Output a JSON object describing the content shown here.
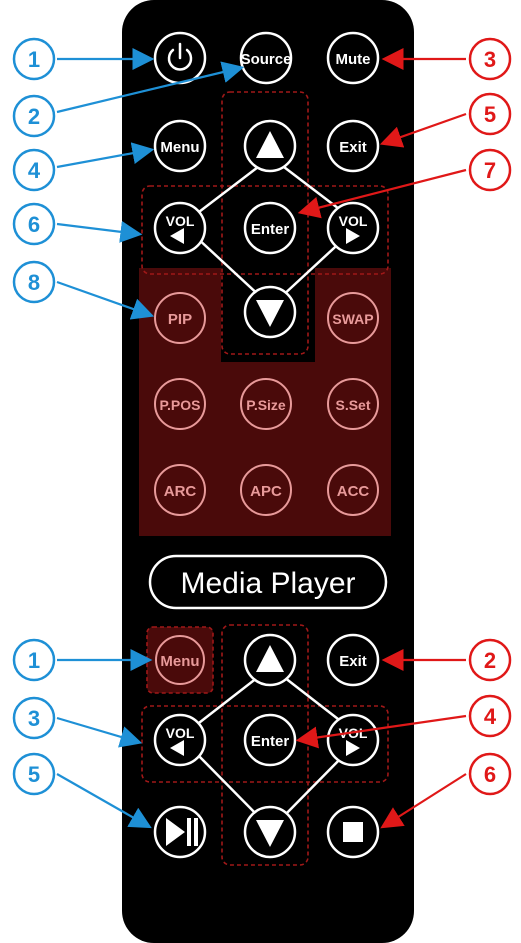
{
  "colors": {
    "body": "#000000",
    "red_zone": "#4a0a0a",
    "dashed": "#a01818",
    "callout_blue": "#1e90d6",
    "callout_red": "#e01818",
    "dim_text": "#e89a9a"
  },
  "top_section": {
    "buttons": {
      "power_icon": "power-icon",
      "source": "Source",
      "mute": "Mute",
      "menu": "Menu",
      "exit": "Exit",
      "up_icon": "triangle-up-icon",
      "down_icon": "triangle-down-icon",
      "enter": "Enter",
      "vol_left": "VOL",
      "vol_right": "VOL",
      "pip": "PIP",
      "swap": "SWAP",
      "ppos": "P.POS",
      "psize": "P.Size",
      "sset": "S.Set",
      "arc": "ARC",
      "apc": "APC",
      "acc": "ACC"
    },
    "callouts": [
      "1",
      "2",
      "3",
      "4",
      "5",
      "6",
      "7",
      "8"
    ]
  },
  "media_player": {
    "label": "Media Player",
    "buttons": {
      "menu": "Menu",
      "exit": "Exit",
      "enter": "Enter",
      "vol_left": "VOL",
      "vol_right": "VOL",
      "up_icon": "triangle-up-icon",
      "down_icon": "triangle-down-icon",
      "play_pause_icon": "play-pause-icon",
      "stop_icon": "stop-icon"
    },
    "callouts": [
      "1",
      "2",
      "3",
      "4",
      "5",
      "6"
    ]
  }
}
